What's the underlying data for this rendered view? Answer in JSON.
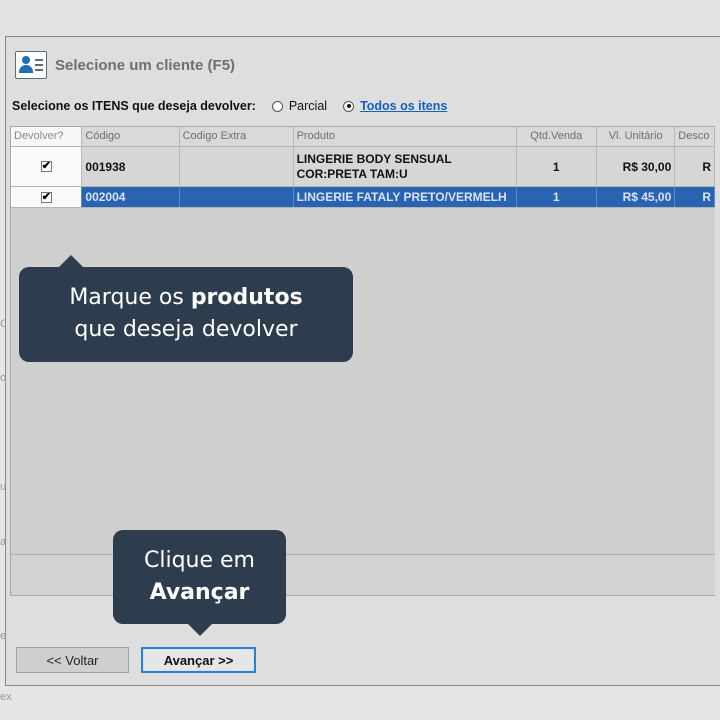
{
  "dialog": {
    "title": "Selecione um cliente (F5)",
    "select_label": "Selecione os ITENS que deseja devolver:",
    "radio_parcial": "Parcial",
    "radio_todos": "Todos os itens"
  },
  "grid": {
    "headers": [
      "Devolver?",
      "Código",
      "Codigo Extra",
      "Produto",
      "Qtd.Venda",
      "Vl. Unitário",
      "Desco"
    ],
    "rows": [
      {
        "checked": "✔",
        "codigo": "001938",
        "codigo_extra": "",
        "produto": "LINGERIE BODY SENSUAL COR:PRETA TAM:U",
        "qtd": "1",
        "valor": "R$ 30,00",
        "desconto": "R"
      },
      {
        "checked": "✔",
        "codigo": "002004",
        "codigo_extra": "",
        "produto": "LINGERIE FATALY PRETO/VERMELH",
        "qtd": "1",
        "valor": "R$ 45,00",
        "desconto": "R"
      }
    ]
  },
  "buttons": {
    "back": "<< Voltar",
    "next": "Avançar >>"
  },
  "tips": {
    "tip1_a": "Marque os ",
    "tip1_b": "produtos",
    "tip1_c": "que deseja devolver",
    "tip2_a": "Clique em",
    "tip2_b": "Avançar"
  },
  "background": {
    "edge_letters": [
      "C",
      "o",
      "us",
      "a",
      "e",
      "ex"
    ]
  },
  "colors": {
    "selected_row": "#2a63b2",
    "tooltip_bg": "#2e3d4e",
    "link": "#1560bd",
    "focus_border": "#2f7fd1"
  }
}
